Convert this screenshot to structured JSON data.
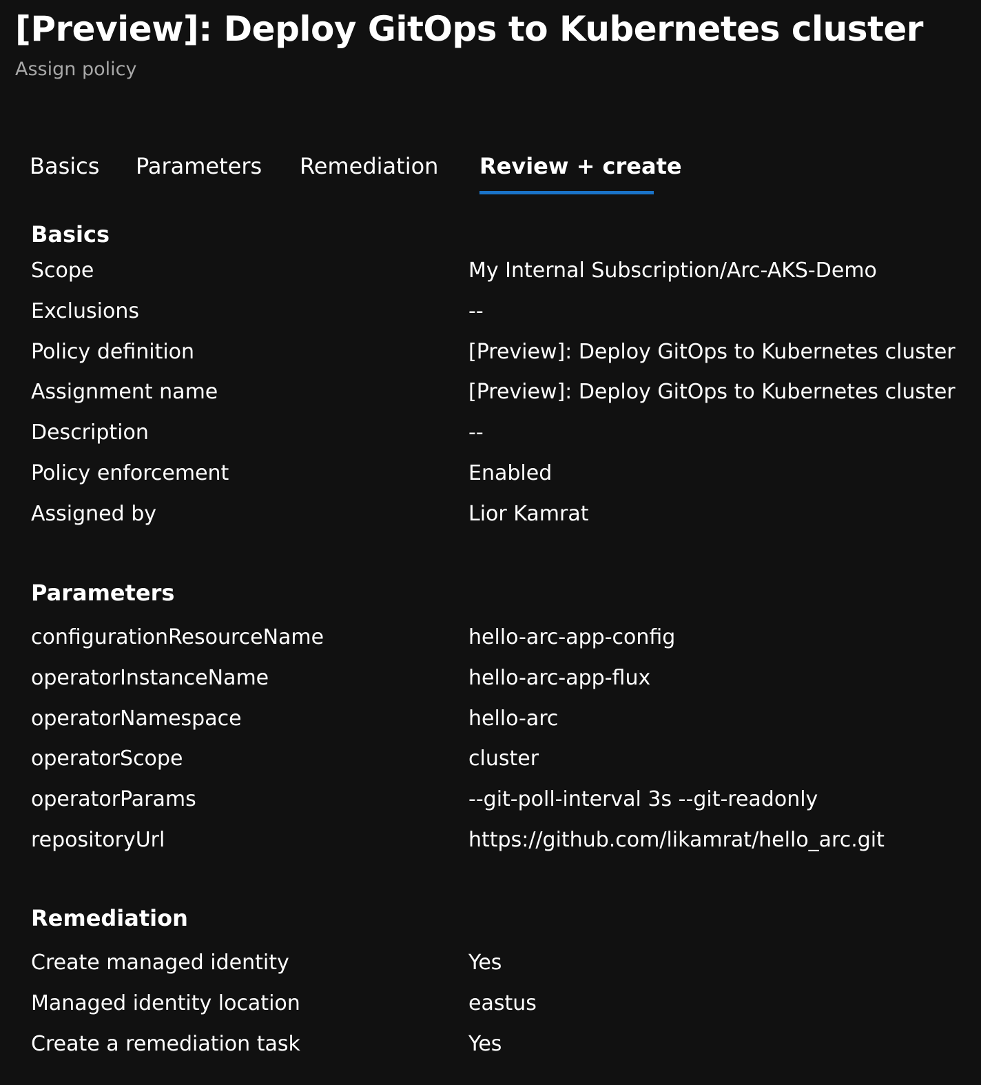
{
  "header": {
    "title": "[Preview]: Deploy GitOps to Kubernetes cluster",
    "subtitle": "Assign policy"
  },
  "tabs": [
    {
      "label": "Basics",
      "active": false
    },
    {
      "label": "Parameters",
      "active": false
    },
    {
      "label": "Remediation",
      "active": false
    },
    {
      "label": "Review + create",
      "active": true
    }
  ],
  "colors": {
    "background": "#111111",
    "text": "#ffffff",
    "subtitle": "#a8a8a8",
    "active_tab_underline": "#1a73c8"
  },
  "sections": {
    "basics": {
      "title": "Basics",
      "rows": [
        {
          "label": "Scope",
          "value": "My Internal Subscription/Arc-AKS-Demo"
        },
        {
          "label": "Exclusions",
          "value": "--"
        },
        {
          "label": "Policy definition",
          "value": "[Preview]: Deploy GitOps to Kubernetes cluster"
        },
        {
          "label": "Assignment name",
          "value": "[Preview]: Deploy GitOps to Kubernetes cluster"
        },
        {
          "label": "Description",
          "value": "--"
        },
        {
          "label": "Policy enforcement",
          "value": "Enabled"
        },
        {
          "label": "Assigned by",
          "value": "Lior Kamrat"
        }
      ]
    },
    "parameters": {
      "title": "Parameters",
      "rows": [
        {
          "label": "configurationResourceName",
          "value": "hello-arc-app-config"
        },
        {
          "label": "operatorInstanceName",
          "value": "hello-arc-app-flux"
        },
        {
          "label": "operatorNamespace",
          "value": "hello-arc"
        },
        {
          "label": "operatorScope",
          "value": "cluster"
        },
        {
          "label": "operatorParams",
          "value": "--git-poll-interval 3s --git-readonly"
        },
        {
          "label": "repositoryUrl",
          "value": "https://github.com/likamrat/hello_arc.git"
        }
      ]
    },
    "remediation": {
      "title": "Remediation",
      "rows": [
        {
          "label": "Create managed identity",
          "value": "Yes"
        },
        {
          "label": "Managed identity location",
          "value": "eastus"
        },
        {
          "label": "Create a remediation task",
          "value": "Yes"
        }
      ]
    }
  }
}
